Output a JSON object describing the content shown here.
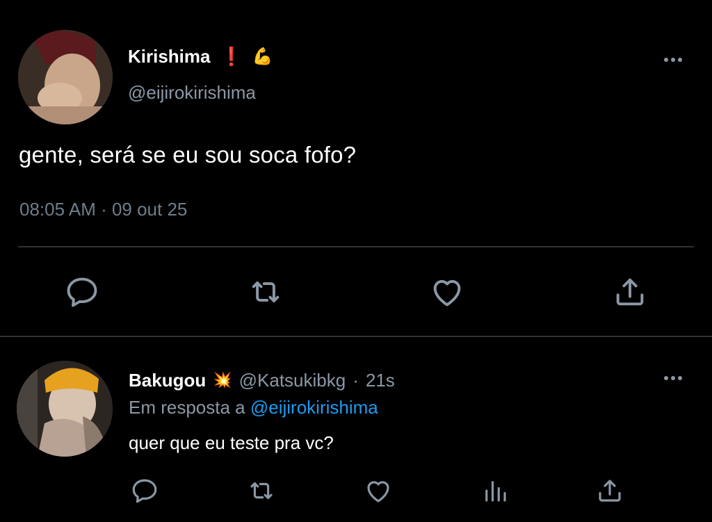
{
  "tweet": {
    "display_name": "Kirishima",
    "name_emoji_1": "❗",
    "name_emoji_2": "💪",
    "handle": "@eijirokirishima",
    "text": "gente, será se eu sou soca fofo?",
    "timestamp": "08:05 AM · 09 out 25",
    "actions": [
      "reply-icon",
      "retweet-icon",
      "like-icon",
      "share-icon"
    ]
  },
  "reply": {
    "display_name": "Bakugou",
    "name_emoji": "💥",
    "handle": "@Katsukibkg",
    "separator": "·",
    "time_ago": "21s",
    "in_reply_prefix": "Em resposta a",
    "in_reply_mention": "@eijirokirishima",
    "text": "quer que eu teste pra vc?",
    "actions": [
      "reply-icon",
      "retweet-icon",
      "like-icon",
      "analytics-icon",
      "share-icon"
    ]
  },
  "colors": {
    "background": "#000000",
    "text_primary": "#ffffff",
    "text_secondary": "#8b98a5",
    "link": "#1d9bf0",
    "divider": "#2f3336",
    "icon": "#8b98a5"
  }
}
